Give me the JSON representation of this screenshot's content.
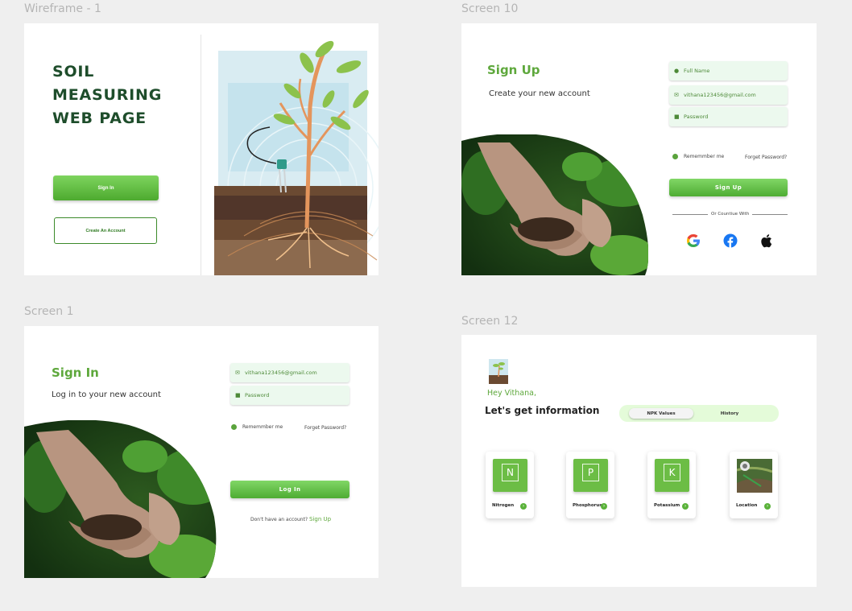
{
  "labels": {
    "wireframe": "Wireframe - 1",
    "screen10": "Screen 10",
    "screen1": "Screen 1",
    "screen12": "Screen 12"
  },
  "wireframe": {
    "title_lines": [
      "SOIL",
      "MEASURING",
      "WEB PAGE"
    ],
    "sign_in": "Sign In",
    "create_account": "Create An Account"
  },
  "screen10": {
    "title": "Sign Up",
    "subtitle": "Create your new account",
    "fullname_placeholder": "Full Name",
    "email_value": "vithana123456@gmail.com",
    "password_placeholder": "Password",
    "remember": "Rememmber me",
    "forgot": "Forget Password?",
    "signup_button": "Sign Up",
    "or_continue": "Or Countiue With",
    "socials": [
      "google-icon",
      "facebook-icon",
      "apple-icon"
    ]
  },
  "screen1": {
    "title": "Sign In",
    "subtitle": "Log in to your new account",
    "email_value": "vithana123456@gmail.com",
    "password_placeholder": "Password",
    "remember": "Rememmber me",
    "forgot": "Forget Password?",
    "login_button": "Log In",
    "no_account": "Don't have an account?",
    "signup_link": "Sign Up"
  },
  "screen12": {
    "greeting": "Hey Vithana,",
    "heading": "Let's get information",
    "tabs": [
      "NPK Values",
      "History"
    ],
    "active_tab": "NPK Values",
    "cards": [
      {
        "symbol": "N",
        "label": "Nitrogen"
      },
      {
        "symbol": "P",
        "label": "Phosphorus"
      },
      {
        "symbol": "K",
        "label": "Potassium"
      },
      {
        "symbol": "",
        "label": "Location"
      }
    ]
  },
  "colors": {
    "brand_green": "#5ea83c",
    "dark_green": "#1e4d2b",
    "field_bg": "#ecf9ee"
  }
}
